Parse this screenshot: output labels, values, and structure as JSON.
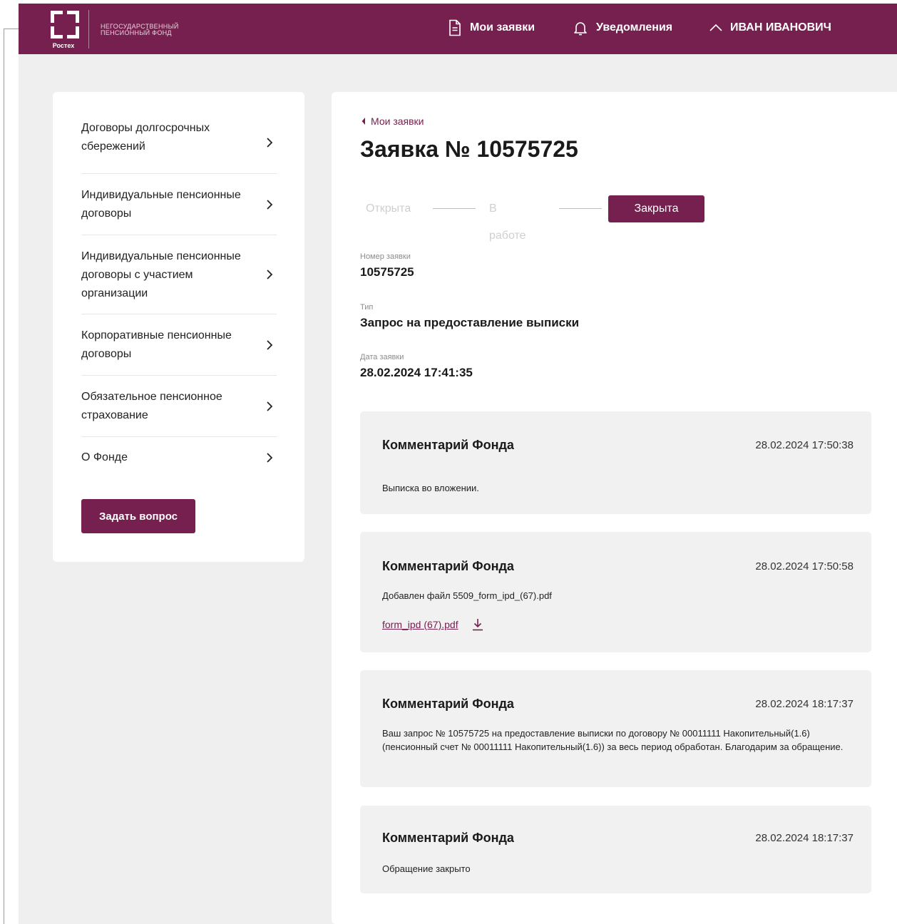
{
  "brand": {
    "logo_text": "Ростех",
    "fund_name_line1": "НЕГОСУДАРСТВЕННЫЙ",
    "fund_name_line2": "ПЕНСИОННЫЙ ФОНД",
    "color": "#76204f"
  },
  "header": {
    "my_requests": "Мои заявки",
    "notifications": "Уведомления",
    "user_name": "ИВАН ИВАНОВИЧ"
  },
  "sidebar": {
    "items": [
      {
        "label": "Договоры долгосрочных сбережений"
      },
      {
        "label": "Индивидуальные пенсионные договоры"
      },
      {
        "label": "Индивидуальные пенсионные договоры с участием организации"
      },
      {
        "label": "Корпоративные пенсионные договоры"
      },
      {
        "label": "Обязательное пенсионное страхование"
      },
      {
        "label": "О Фонде"
      }
    ],
    "ask_button": "Задать вопрос"
  },
  "main": {
    "back_link": "Мои заявки",
    "title": "Заявка № 10575725",
    "steps": [
      "Открыта",
      "В работе",
      "Закрыта"
    ],
    "active_step": "Закрыта",
    "fields": {
      "number_label": "Номер заявки",
      "number_value": "10575725",
      "type_label": "Тип",
      "type_value": "Запрос на предоставление выписки",
      "date_label": "Дата заявки",
      "date_value": "28.02.2024 17:41:35"
    },
    "comments": [
      {
        "title": "Комментарий Фонда",
        "date": "28.02.2024 17:50:38",
        "text": "Выписка во вложении."
      },
      {
        "title": "Комментарий Фонда",
        "date": "28.02.2024 17:50:58",
        "text": "Добавлен файл 5509_form_ipd_(67).pdf",
        "file": "form_ipd (67).pdf"
      },
      {
        "title": "Комментарий Фонда",
        "date": "28.02.2024 18:17:37",
        "text": "Ваш запрос № 10575725 на предоставление выписки по договору № 00011111 Накопительный(1.6) (пенсионный счет № 00011111 Накопительный(1.6)) за весь период обработан. Благодарим за обращение."
      },
      {
        "title": "Комментарий Фонда",
        "date": "28.02.2024 18:17:37",
        "text": "Обращение закрыто"
      }
    ]
  }
}
